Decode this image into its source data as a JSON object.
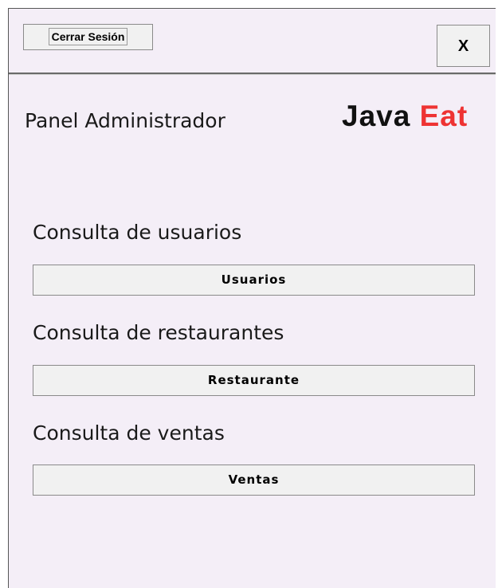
{
  "header": {
    "logout_label": "Cerrar Sesión",
    "close_label": "X"
  },
  "main": {
    "panel_title": "Panel Administrador",
    "logo": {
      "part1": "Java",
      "part2": "Eat",
      "accent_color": "#ee3333"
    },
    "sections": [
      {
        "title": "Consulta de usuarios",
        "button_label": "Usuarios"
      },
      {
        "title": "Consulta de restaurantes",
        "button_label": "Restaurante"
      },
      {
        "title": "Consulta de ventas",
        "button_label": "Ventas"
      }
    ]
  },
  "colors": {
    "window_background": "#f4eef7",
    "button_background": "#f1f1f1"
  }
}
